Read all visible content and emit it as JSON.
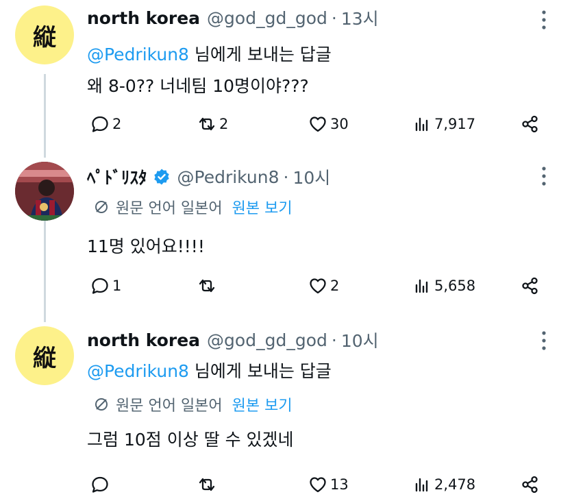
{
  "tweets": [
    {
      "avatar": {
        "kind": "kanji",
        "glyph": "縦",
        "bg": "#fdf18a"
      },
      "name": "north korea",
      "handle": "@god_gd_god",
      "dot": "·",
      "time": "13시",
      "reply_mention": "@Pedrikun8",
      "reply_suffix": " 님에게 보내는 답글",
      "translate": null,
      "text": "왜 8-0?? 너네팀 10명이야???",
      "actions": {
        "replies": "2",
        "reposts": "2",
        "likes": "30",
        "views": "7,917"
      }
    },
    {
      "avatar": {
        "kind": "photo"
      },
      "name": "ﾍﾟﾄﾞﾘｽﾀ",
      "verified": true,
      "handle": "@Pedrikun8",
      "dot": "·",
      "time": "10시",
      "reply_mention": null,
      "translate": {
        "label": "원문 언어 일본어",
        "link": "원본 보기"
      },
      "text": "11명 있어요!!!!",
      "actions": {
        "replies": "1",
        "reposts": "",
        "likes": "2",
        "views": "5,658"
      }
    },
    {
      "avatar": {
        "kind": "kanji",
        "glyph": "縦",
        "bg": "#fdf18a"
      },
      "name": "north korea",
      "handle": "@god_gd_god",
      "dot": "·",
      "time": "10시",
      "reply_mention": "@Pedrikun8",
      "reply_suffix": " 님에게 보내는 답글",
      "translate": {
        "label": "원문 언어 일본어",
        "link": "원본 보기"
      },
      "text": "그럼 10점 이상 딸 수 있겠네",
      "actions": {
        "replies": "",
        "reposts": "",
        "likes": "13",
        "views": "2,478"
      }
    }
  ],
  "colors": {
    "accent": "#1d9bf0",
    "secondary_text": "#536471",
    "primary_text": "#0f1419",
    "thread_line": "#cfd9de"
  }
}
